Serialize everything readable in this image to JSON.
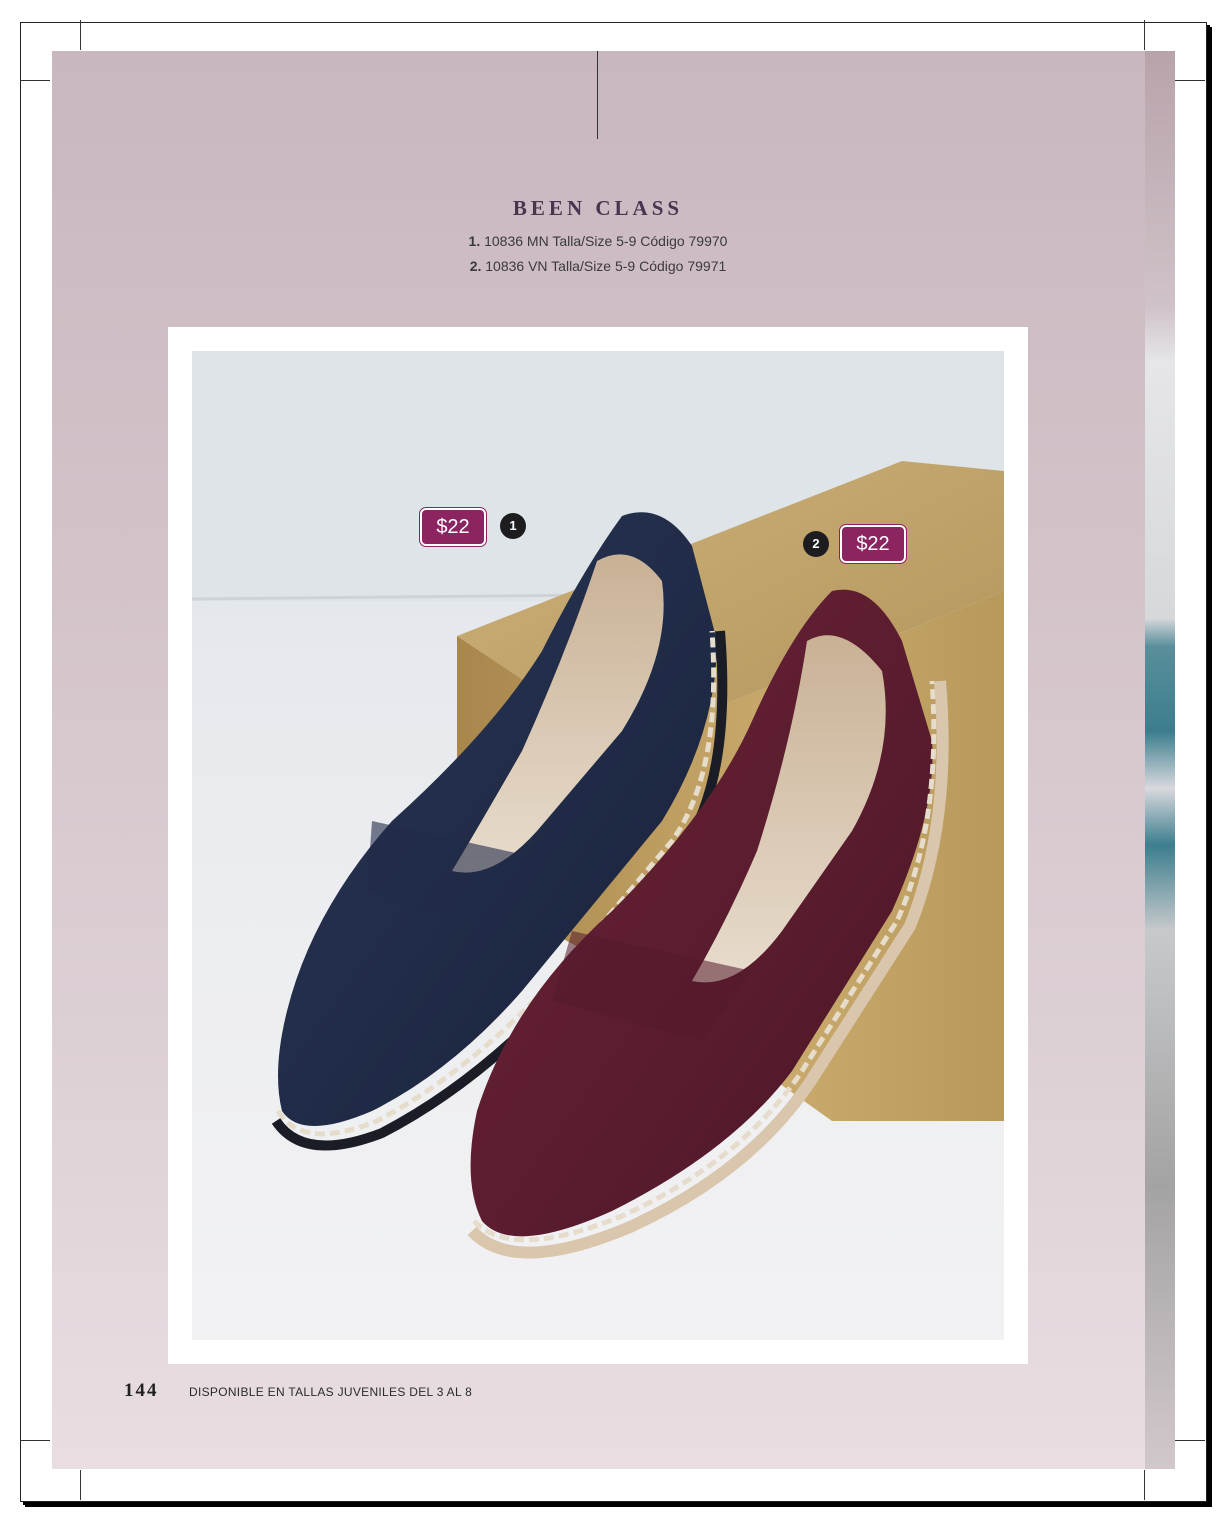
{
  "catalog": {
    "title": "BEEN CLASS",
    "items": [
      {
        "num": "1.",
        "desc": "10836 MN Talla/Size 5-9 Código 79970"
      },
      {
        "num": "2.",
        "desc": "10836 VN Talla/Size 5-9 Código 79971"
      }
    ]
  },
  "product_photo": {
    "tags": [
      {
        "num": "1",
        "price": "$22",
        "color_name": "navy",
        "color": "#1f2a45"
      },
      {
        "num": "2",
        "price": "$22",
        "color_name": "wine",
        "color": "#5a1b2e"
      }
    ],
    "brand_colors": {
      "price_tag": "#8b2461",
      "badge": "#1d1d1f"
    }
  },
  "footer": {
    "page_number": "144",
    "note": "DISPONIBLE EN TALLAS JUVENILES DEL 3 AL 8"
  }
}
